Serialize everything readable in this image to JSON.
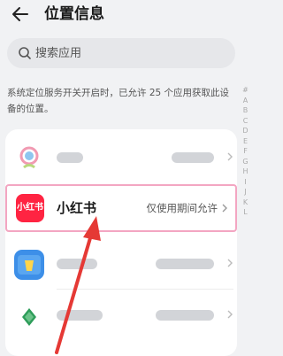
{
  "header": {
    "title": "位置信息"
  },
  "search": {
    "placeholder": "搜索应用"
  },
  "description": "系统定位服务开关开启时，已允许 25 个应用获取此设备的位置。",
  "alphabet": [
    "#",
    "A",
    "B",
    "C",
    "D",
    "E",
    "F",
    "G",
    "H",
    "I",
    "J",
    "K",
    "L"
  ],
  "apps": {
    "highlighted": {
      "icon_text": "小红书",
      "name": "小红书",
      "permission": "仅使用期间允许",
      "brand_color": "#ff2442"
    }
  },
  "colors": {
    "background": "#f1f2f4",
    "highlight_border": "#f3a6c2",
    "arrow": "#e53935"
  }
}
